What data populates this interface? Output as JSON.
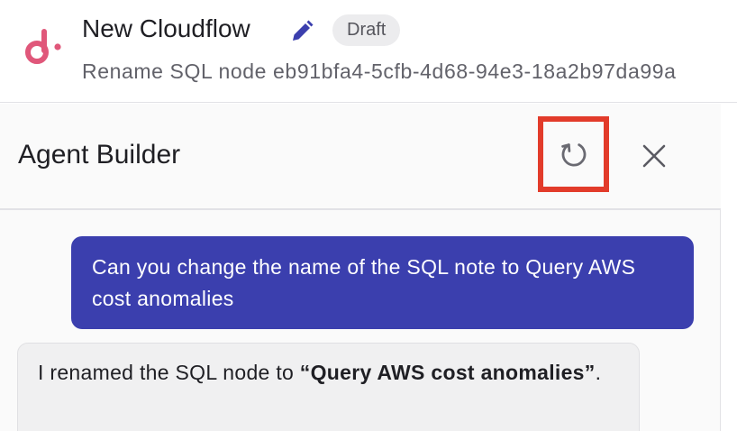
{
  "header": {
    "title": "New Cloudflow",
    "status_badge": "Draft",
    "subtitle": "Rename SQL node eb91bfa4-5cfb-4d68-94e3-18a2b97da99a",
    "logo_icon": "d-logo-icon",
    "edit_icon": "pencil-icon",
    "colors": {
      "logo": "#e0577a",
      "edit": "#3b3fae"
    }
  },
  "agent_builder": {
    "title": "Agent Builder",
    "reset_icon": "refresh-icon",
    "close_icon": "close-icon",
    "highlight_color": "#e23b2a"
  },
  "chat": {
    "user_message": "Can you change the name of the SQL note to Query AWS cost anomalies",
    "agent_message": {
      "prefix": "I renamed the SQL node to ",
      "bold": "“Query AWS cost anomalies”",
      "suffix": "."
    },
    "colors": {
      "user_bubble": "#3b3fae",
      "agent_bubble": "#f0f0f1"
    }
  }
}
